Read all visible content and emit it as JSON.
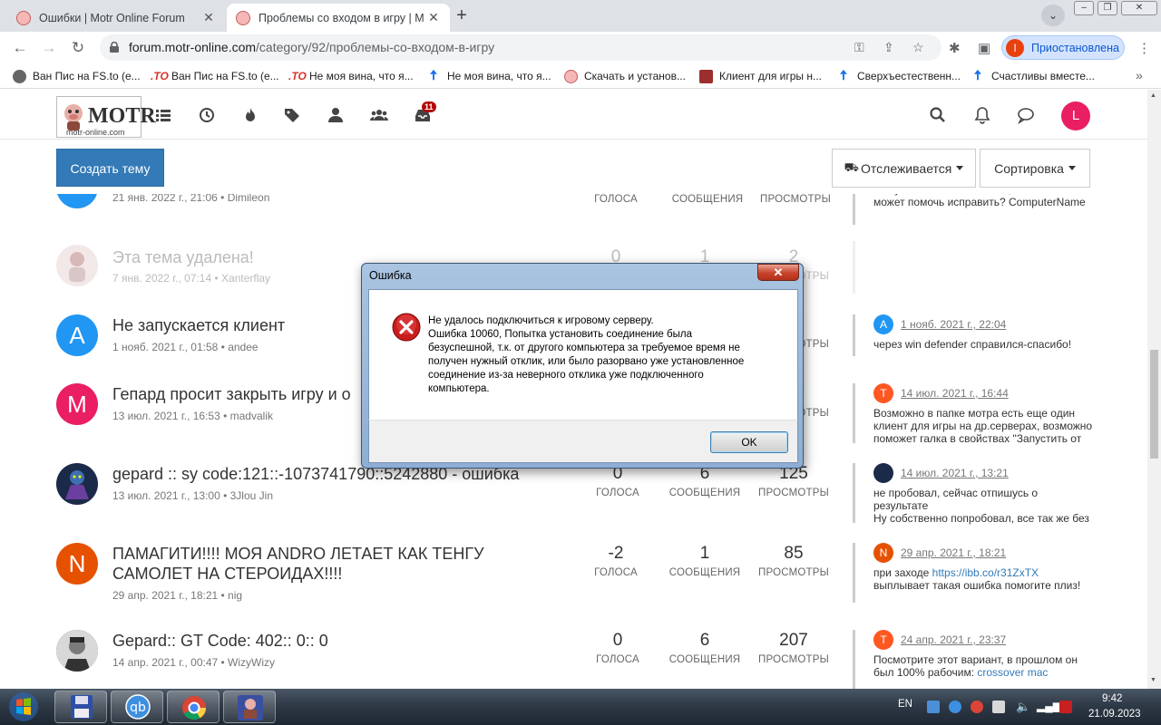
{
  "browser": {
    "tabs": [
      {
        "title": "Ошибки | Motr Online Forum",
        "active": false
      },
      {
        "title": "Проблемы со входом в игру | M",
        "active": true
      }
    ],
    "url_host": "forum.motr-online.com",
    "url_path": "/category/92/проблемы-со-входом-в-игру",
    "profile_initial": "I",
    "profile_label": "Приостановлена",
    "bookmarks": [
      {
        "label": "Ван Пис на FS.to (е...",
        "icon": "globe-icon"
      },
      {
        "label": "Ван Пис на FS.to (е...",
        "icon": "fsto-icon"
      },
      {
        "label": "Не моя вина, что я...",
        "icon": "fsto-icon"
      },
      {
        "label": "Не моя вина, что я...",
        "icon": "arrow-up-icon"
      },
      {
        "label": "Скачать и установ...",
        "icon": "pig-icon"
      },
      {
        "label": "Клиент для игры н...",
        "icon": "client-icon"
      },
      {
        "label": "Сверхъестественн...",
        "icon": "arrow-up-icon"
      },
      {
        "label": "Счастливы вместе...",
        "icon": "arrow-up-icon"
      }
    ]
  },
  "forum": {
    "logo_text": "MOTR",
    "logo_sub": "motr-online.com",
    "notification_count": "11",
    "user_initial": "L",
    "create_topic_label": "Создать тему",
    "watch_label": "Отслеживается",
    "sort_label": "Сортировка",
    "stat_labels": {
      "votes": "ГОЛОСА",
      "posts": "СООБЩЕНИЯ",
      "views": "ПРОСМОТРЫ"
    },
    "topics": [
      {
        "title": "",
        "meta": "21 янв. 2022 г., 21:06 • Dimileon",
        "avatar_letter": "",
        "avatar_color": "#2196f3",
        "votes": "",
        "posts": "",
        "views": "",
        "last_date": "",
        "last_text": "регулярно получаю ошибку. сервер в статусе онлайн. Тест ниже, пинг есть. Кто может помочь исправить? ComputerName"
      },
      {
        "title": "Эта тема удалена!",
        "meta": "7 янв. 2022 г., 07:14 • Xanterflay",
        "avatar_letter": "",
        "avatar_color": "#e0d0d0",
        "votes": "0",
        "posts": "1",
        "views": "2",
        "last_date": "",
        "last_text": ""
      },
      {
        "title": "Не запускается клиент",
        "meta": "1 нояб. 2021 г., 01:58 • andee",
        "avatar_letter": "A",
        "avatar_color": "#2196f3",
        "votes": "",
        "posts": "",
        "views": "9",
        "last_letter": "A",
        "last_color": "#2196f3",
        "last_date": "1 нояб. 2021 г., 22:04",
        "last_text": "через win defender справился-спасибо!"
      },
      {
        "title": "Гепард просит закрыть игру и о",
        "meta": "13 июл. 2021 г., 16:53 • madvalik",
        "avatar_letter": "M",
        "avatar_color": "#e91e63",
        "votes": "",
        "posts": "",
        "views": "6",
        "last_letter": "T",
        "last_color": "#ff5722",
        "last_date": "14 июл. 2021 г., 16:44",
        "last_text": "Возможно в папке мотра есть еще один клиент для игры на др.серверах, возможно поможет галка в свойствах \"Запустить от"
      },
      {
        "title": "gepard :: sy code:121::-1073741790::5242880 - ошибка",
        "meta": "13 июл. 2021 г., 13:00 • 3Jlou Jin",
        "avatar_letter": "",
        "avatar_color": "#1a2a48",
        "votes": "0",
        "posts": "6",
        "views": "125",
        "last_letter": "",
        "last_color": "#1a2a48",
        "last_date": "14 июл. 2021 г., 13:21",
        "last_text": "не пробовал, сейчас отпишусь о результате\nНу собственно попробовал, все так же без"
      },
      {
        "title": "ПАМАГИТИ!!!! МОЯ ANDRO ЛЕТАЕТ КАК ТЕНГУ САМОЛЕТ НА СТЕРОИДАХ!!!!",
        "meta": "29 апр. 2021 г., 18:21 • nig",
        "avatar_letter": "N",
        "avatar_color": "#e65100",
        "votes": "-2",
        "posts": "1",
        "views": "85",
        "last_letter": "N",
        "last_color": "#e65100",
        "last_date": "29 апр. 2021 г., 18:21",
        "last_text_prefix": "при заходе ",
        "last_link": "https://ibb.co/r31ZxTX",
        "last_text_suffix": " выплывает такая ошибка помогите плиз!"
      },
      {
        "title": "Gepard:: GT Code: 402:: 0:: 0",
        "meta": "14 апр. 2021 г., 00:47 • WizyWizy",
        "avatar_letter": "",
        "avatar_color": "#555555",
        "votes": "0",
        "posts": "6",
        "views": "207",
        "last_letter": "T",
        "last_color": "#ff5722",
        "last_date": "24 апр. 2021 г., 23:37",
        "last_text_prefix": "Посмотрите этот вариант, в прошлом он был 100% рабочим: ",
        "last_link": "crossover mac",
        "last_text_suffix": ""
      }
    ]
  },
  "dialog": {
    "title": "Ошибка",
    "close_label": "✕",
    "message_lines": [
      "Не удалось подключиться к игровому серверу.",
      "Ошибка 10060, Попытка установить соединение была",
      "безуспешной, т.к. от другого компьютера за требуемое время не",
      "получен нужный отклик, или было разорвано уже установленное",
      "соединение из-за неверного отклика уже подключенного",
      "компьютера."
    ],
    "ok_label": "OK"
  },
  "taskbar": {
    "lang": "EN",
    "time": "9:42",
    "date": "21.09.2023",
    "apps": [
      "floppy-icon",
      "qbittorrent-icon",
      "chrome-icon",
      "game-icon"
    ]
  }
}
